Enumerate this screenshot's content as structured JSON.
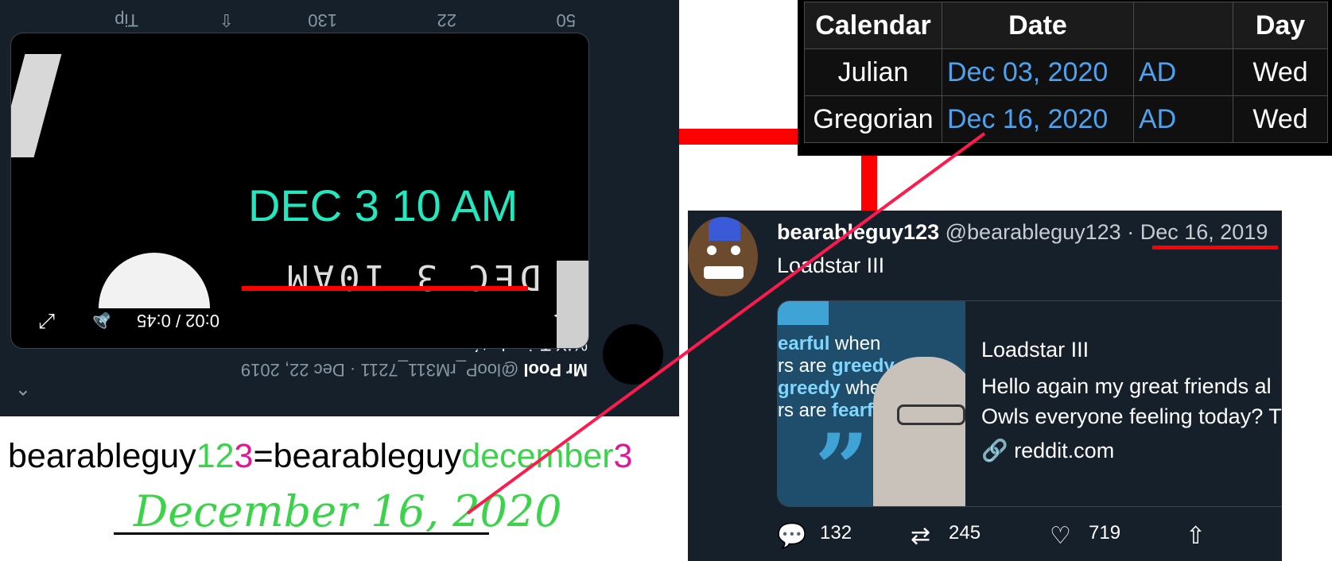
{
  "flipped_tweet": {
    "author_name": "Mr Pool",
    "author_meta": "@looP_rM311_7211 · Dec 22, 2019",
    "text": "%IX Toic ekatό",
    "actions": {
      "replies": "50",
      "retweets": "22",
      "likes": "130",
      "tip": "Tip"
    },
    "video_time": "0:02 / 0:45"
  },
  "video_overlay": {
    "caption": "DEC 3 10 AM",
    "caption_color": "#22e8c0",
    "underline_color": "#ff0000"
  },
  "equation": {
    "left_prefix": "bearableguy",
    "left_d1": "1",
    "left_d2": "2",
    "left_d3": "3",
    "equals": "=",
    "right_prefix": "bearableguy",
    "right_word": "december",
    "right_digit": "3",
    "green": "#3ad34a",
    "magenta": "#e0179a"
  },
  "handwritten_date": "December 16, 2020",
  "calendar_table": {
    "headers": [
      "Calendar",
      "Date",
      "",
      "Day"
    ],
    "rows": [
      {
        "calendar": "Julian",
        "date": "Dec 03, 2020",
        "era": "AD",
        "day": "Wed"
      },
      {
        "calendar": "Gregorian",
        "date": "Dec 16, 2020",
        "era": "AD",
        "day": "Wed"
      }
    ]
  },
  "tweet": {
    "display_name": "bearableguy123",
    "handle": "@bearableguy123",
    "separator": "·",
    "date": "Dec 16, 2019",
    "text": "Loadstar III",
    "card": {
      "title": "Loadstar III",
      "line1": "Hello again my great friends al",
      "line2": "Owls everyone feeling today? T",
      "link": "reddit.com",
      "quote": [
        {
          "strong": "earful",
          "normal": " when"
        },
        {
          "strong": "",
          "normal": "rs are ",
          "strong2": "greedy"
        },
        {
          "strong": "greedy",
          "normal": " when"
        },
        {
          "strong": "",
          "normal": "rs are ",
          "strong2": "fearful"
        }
      ]
    },
    "stats": {
      "replies": "132",
      "retweets": "245",
      "likes": "719"
    }
  },
  "colors": {
    "accent_red": "#ff0000",
    "link_blue": "#4ea3f0",
    "diagonal_line": "#ff1a4d",
    "twitter_bg": "#15202b"
  }
}
